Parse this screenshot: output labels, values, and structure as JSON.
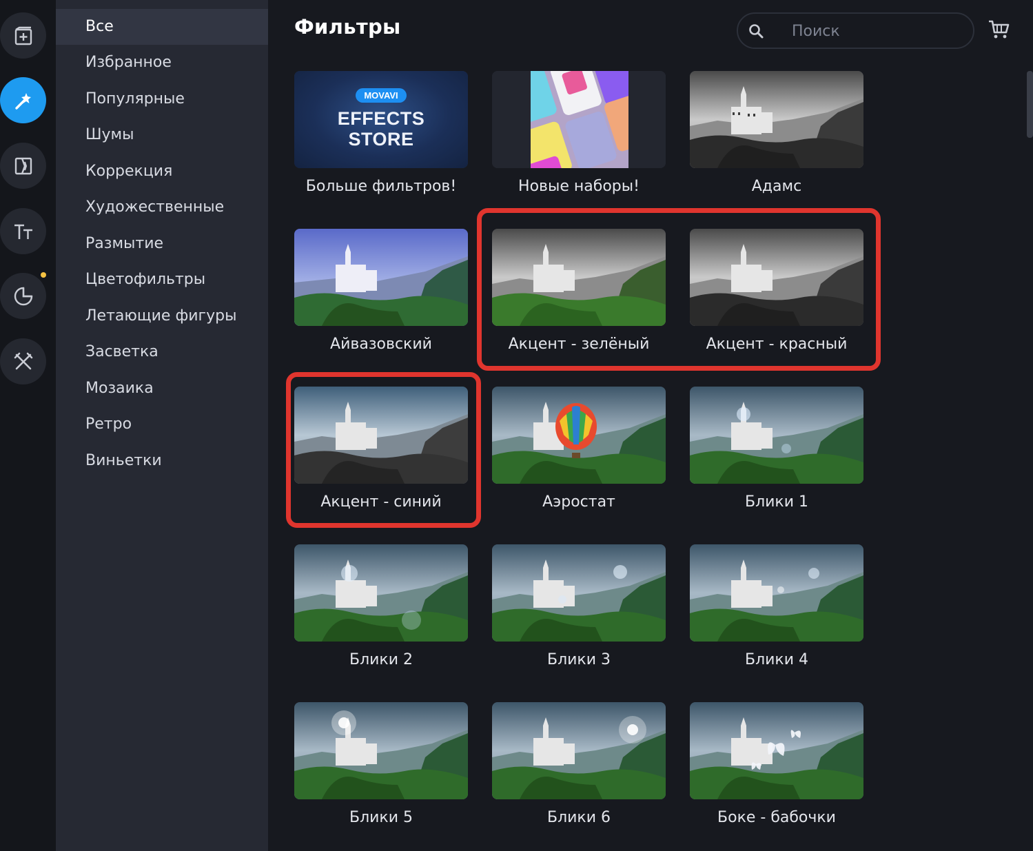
{
  "rail": {
    "tools": [
      {
        "name": "import",
        "icon": "add-media-icon",
        "active": false
      },
      {
        "name": "filters",
        "icon": "magic-wand-icon",
        "active": true
      },
      {
        "name": "transitions",
        "icon": "transition-icon",
        "active": false
      },
      {
        "name": "titles",
        "icon": "text-icon",
        "active": false
      },
      {
        "name": "stickers",
        "icon": "sticker-icon",
        "active": false,
        "has_dot": true
      },
      {
        "name": "tools",
        "icon": "tools-icon",
        "active": false
      }
    ],
    "accent_color": "#1e9bf0",
    "dot_color": "#f5c242"
  },
  "categories": {
    "items": [
      {
        "label": "Все",
        "active": true
      },
      {
        "label": "Избранное"
      },
      {
        "label": "Популярные"
      },
      {
        "label": "Шумы"
      },
      {
        "label": "Коррекция"
      },
      {
        "label": "Художественные"
      },
      {
        "label": "Размытие"
      },
      {
        "label": "Цветофильтры"
      },
      {
        "label": "Летающие фигуры"
      },
      {
        "label": "Засветка"
      },
      {
        "label": "Мозаика"
      },
      {
        "label": "Ретро"
      },
      {
        "label": "Виньетки"
      }
    ]
  },
  "header": {
    "title": "Фильтры",
    "search_placeholder": "Поиск"
  },
  "store_promo": {
    "badge": "MOVAVI",
    "title_line1": "EFFECTS",
    "title_line2": "STORE"
  },
  "filters": [
    {
      "label": "Больше фильтров!",
      "thumb": "store"
    },
    {
      "label": "Новые наборы!",
      "thumb": "sets"
    },
    {
      "label": "Адамс",
      "thumb": "bw"
    },
    {
      "label": "Айвазовский",
      "thumb": "painterly"
    },
    {
      "label": "Акцент - зелёный",
      "thumb": "accent-green"
    },
    {
      "label": "Акцент - красный",
      "thumb": "accent-red"
    },
    {
      "label": "Акцент - синий",
      "thumb": "accent-blue"
    },
    {
      "label": "Аэростат",
      "thumb": "balloon"
    },
    {
      "label": "Блики 1",
      "thumb": "flare"
    },
    {
      "label": "Блики 2",
      "thumb": "flare"
    },
    {
      "label": "Блики 3",
      "thumb": "flare"
    },
    {
      "label": "Блики 4",
      "thumb": "flare"
    },
    {
      "label": "Блики 5",
      "thumb": "flare-sun"
    },
    {
      "label": "Блики 6",
      "thumb": "flare-sun2"
    },
    {
      "label": "Боке - бабочки",
      "thumb": "butterflies"
    }
  ],
  "highlight_color": "#e0352e"
}
